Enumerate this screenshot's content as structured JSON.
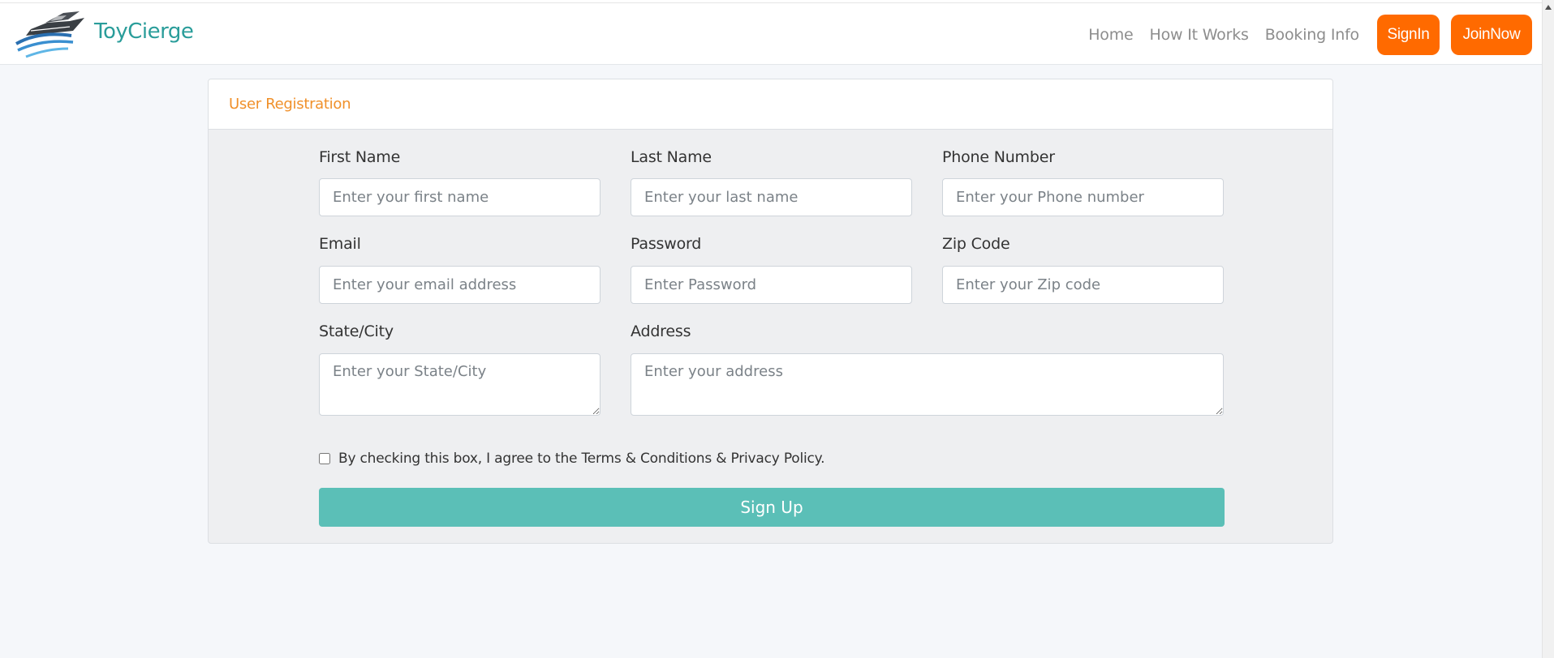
{
  "brand": {
    "name": "ToyCierge",
    "logo_icon": "yacht-logo-icon"
  },
  "nav": {
    "links": [
      "Home",
      "How It Works",
      "Booking Info"
    ],
    "signin_label": "SignIn",
    "join_label": "JoinNow",
    "button_color": "#ff6a00"
  },
  "card": {
    "title": "User Registration",
    "title_color": "#f0902a"
  },
  "form": {
    "first_name": {
      "label": "First Name",
      "placeholder": "Enter your first name",
      "value": ""
    },
    "last_name": {
      "label": "Last Name",
      "placeholder": "Enter your last name",
      "value": ""
    },
    "phone": {
      "label": "Phone Number",
      "placeholder": "Enter your Phone number",
      "value": ""
    },
    "email": {
      "label": "Email",
      "placeholder": "Enter your email address",
      "value": ""
    },
    "password": {
      "label": "Password",
      "placeholder": "Enter Password",
      "value": ""
    },
    "zip": {
      "label": "Zip Code",
      "placeholder": "Enter your Zip code",
      "value": ""
    },
    "state_city": {
      "label": "State/City",
      "placeholder": "Enter your State/City",
      "value": ""
    },
    "address": {
      "label": "Address",
      "placeholder": "Enter your address",
      "value": ""
    },
    "agree_text": "By checking this box, I agree to the Terms & Conditions & Privacy Policy.",
    "agree_checked": false,
    "submit_label": "Sign Up",
    "submit_color": "#5bbfb7"
  }
}
